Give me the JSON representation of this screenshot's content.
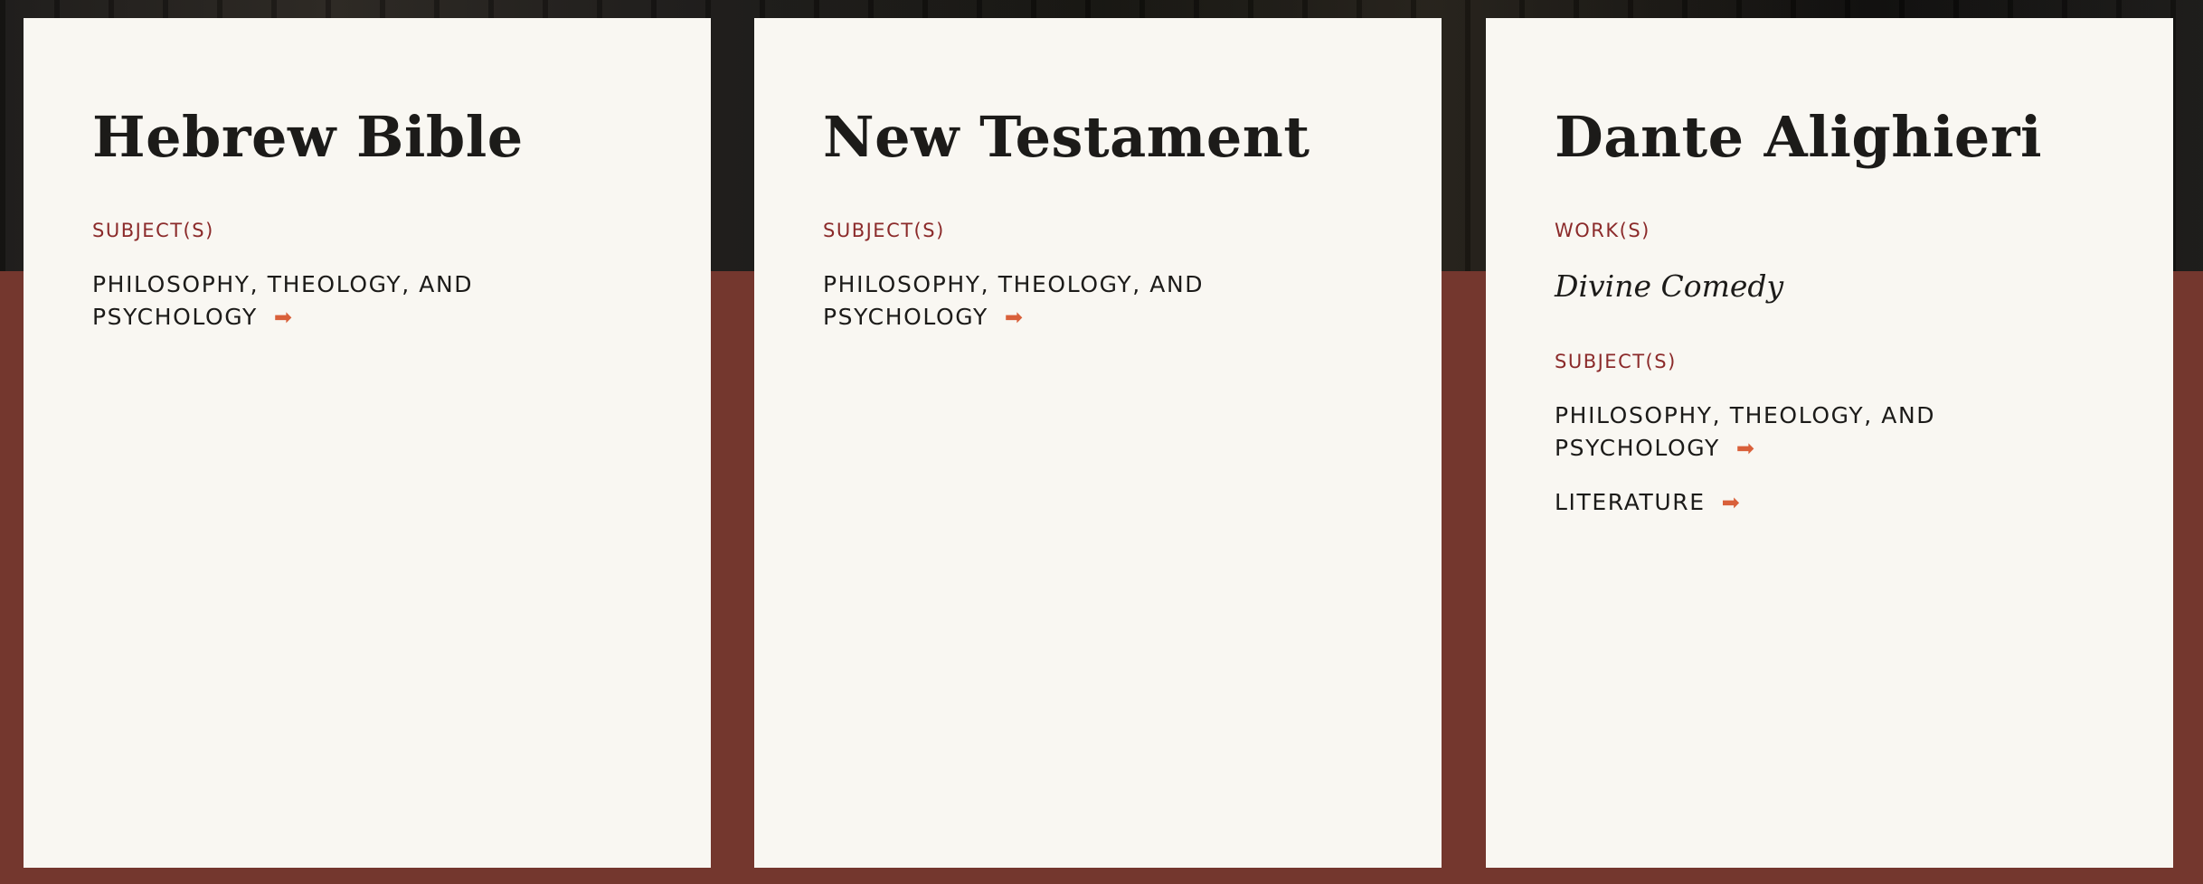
{
  "colors": {
    "accent_label": "#8b2a2a",
    "arrow": "#d9603a",
    "card": "#f9f7f2",
    "band": "#74372e"
  },
  "cards": [
    {
      "title": "Hebrew Bible",
      "subjects_label": "SUBJECT(S)",
      "subjects": [
        "PHILOSOPHY, THEOLOGY, AND PSYCHOLOGY"
      ]
    },
    {
      "title": "New Testament",
      "subjects_label": "SUBJECT(S)",
      "subjects": [
        "PHILOSOPHY, THEOLOGY, AND PSYCHOLOGY"
      ]
    },
    {
      "title": "Dante Alighieri",
      "works_label": "WORK(S)",
      "works": [
        "Divine Comedy"
      ],
      "subjects_label": "SUBJECT(S)",
      "subjects": [
        "PHILOSOPHY, THEOLOGY, AND PSYCHOLOGY",
        "LITERATURE"
      ]
    }
  ],
  "icons": {
    "arrow": "arrow-right-icon"
  }
}
